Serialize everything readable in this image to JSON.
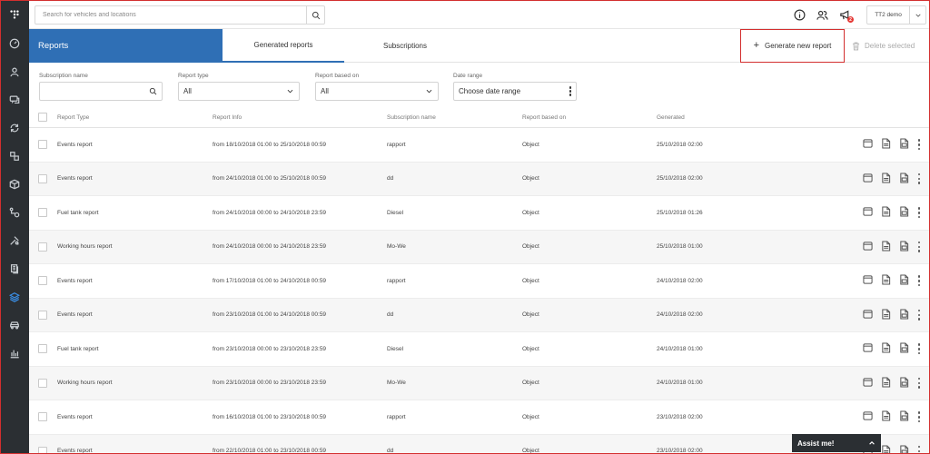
{
  "search": {
    "placeholder": "Search for vehicles and locations"
  },
  "account": {
    "name": "TT2 demo",
    "notifications": "2"
  },
  "header": {
    "title": "Reports",
    "tabs": [
      "Generated reports",
      "Subscriptions"
    ],
    "generate_label": "Generate new report",
    "delete_label": "Delete selected"
  },
  "filters": {
    "subscription_name": {
      "label": "Subscription name",
      "value": ""
    },
    "report_type": {
      "label": "Report type",
      "value": "All"
    },
    "report_based_on": {
      "label": "Report based on",
      "value": "All"
    },
    "date_range": {
      "label": "Date range",
      "value": "Choose date range"
    }
  },
  "table": {
    "columns": [
      "Report Type",
      "Report Info",
      "Subscription name",
      "Report based on",
      "Generated"
    ],
    "rows": [
      [
        "Events report",
        "from 18/10/2018 01:00 to 25/10/2018 00:59",
        "rapport",
        "Object",
        "25/10/2018 02:00"
      ],
      [
        "Events report",
        "from 24/10/2018 01:00 to 25/10/2018 00:59",
        "dd",
        "Object",
        "25/10/2018 02:00"
      ],
      [
        "Fuel tank report",
        "from 24/10/2018 00:00 to 24/10/2018 23:59",
        "Diesel",
        "Object",
        "25/10/2018 01:26"
      ],
      [
        "Working hours report",
        "from 24/10/2018 00:00 to 24/10/2018 23:59",
        "Mo-We",
        "Object",
        "25/10/2018 01:00"
      ],
      [
        "Events report",
        "from 17/10/2018 01:00 to 24/10/2018 00:59",
        "rapport",
        "Object",
        "24/10/2018 02:00"
      ],
      [
        "Events report",
        "from 23/10/2018 01:00 to 24/10/2018 00:59",
        "dd",
        "Object",
        "24/10/2018 02:00"
      ],
      [
        "Fuel tank report",
        "from 23/10/2018 00:00 to 23/10/2018 23:59",
        "Diesel",
        "Object",
        "24/10/2018 01:00"
      ],
      [
        "Working hours report",
        "from 23/10/2018 00:00 to 23/10/2018 23:59",
        "Mo-We",
        "Object",
        "24/10/2018 01:00"
      ],
      [
        "Events report",
        "from 16/10/2018 01:00 to 23/10/2018 00:59",
        "rapport",
        "Object",
        "23/10/2018 02:00"
      ],
      [
        "Events report",
        "from 22/10/2018 01:00 to 23/10/2018 00:59",
        "dd",
        "Object",
        "23/10/2018 02:00"
      ]
    ]
  },
  "assist": {
    "label": "Assist me!"
  },
  "colors": {
    "brand": "#2f6fb5",
    "sidebar": "#2b2f33",
    "highlight": "#d32f2f"
  }
}
